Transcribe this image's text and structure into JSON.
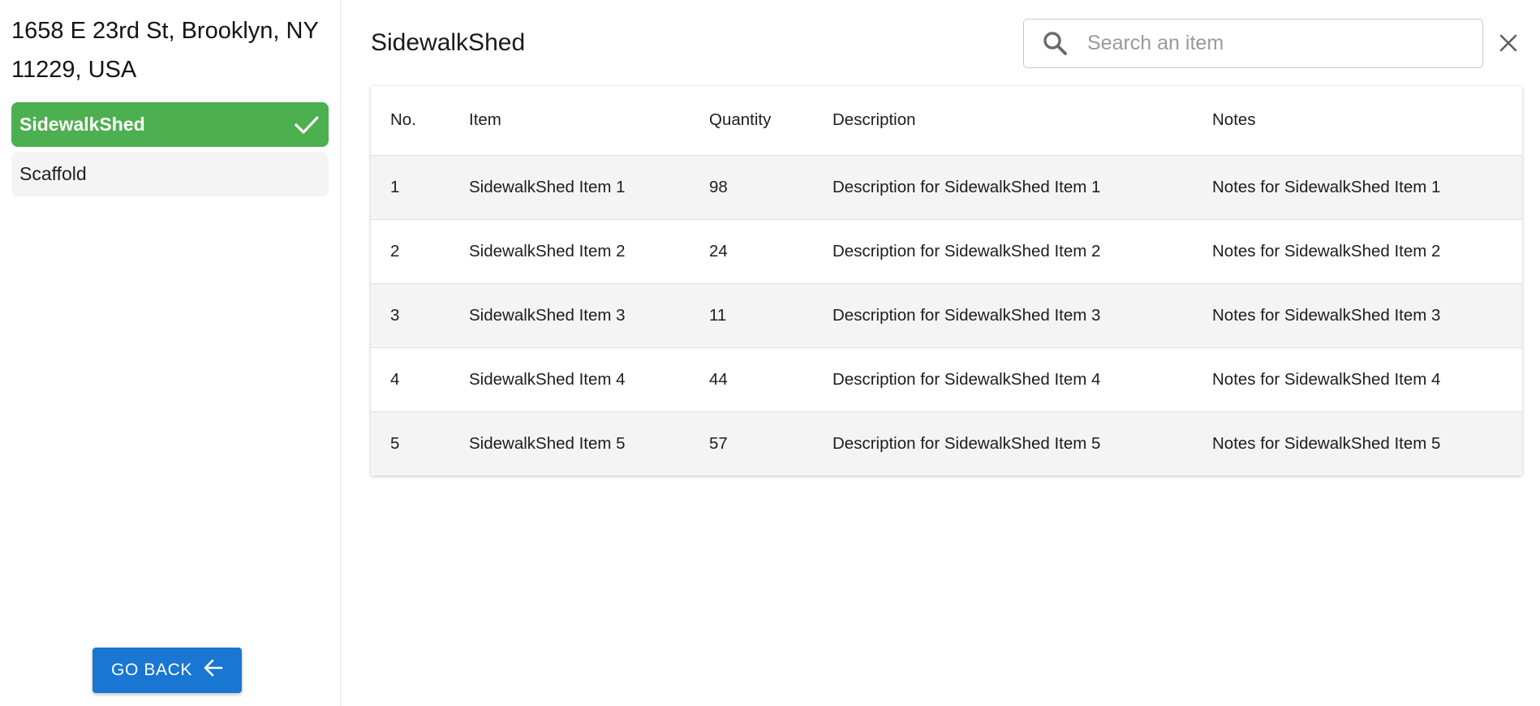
{
  "sidebar": {
    "address": "1658 E 23rd St, Brooklyn, NY 11229, USA",
    "items": [
      {
        "label": "SidewalkShed",
        "active": true,
        "icon": "check-icon"
      },
      {
        "label": "Scaffold",
        "active": false
      }
    ],
    "go_back_label": "GO BACK"
  },
  "header": {
    "title": "SidewalkShed",
    "search_placeholder": "Search an item",
    "search_value": ""
  },
  "table": {
    "columns": [
      "No.",
      "Item",
      "Quantity",
      "Description",
      "Notes"
    ],
    "rows": [
      {
        "no": "1",
        "item": "SidewalkShed Item 1",
        "quantity": "98",
        "description": "Description for SidewalkShed Item 1",
        "notes": "Notes for SidewalkShed Item 1"
      },
      {
        "no": "2",
        "item": "SidewalkShed Item 2",
        "quantity": "24",
        "description": "Description for SidewalkShed Item 2",
        "notes": "Notes for SidewalkShed Item 2"
      },
      {
        "no": "3",
        "item": "SidewalkShed Item 3",
        "quantity": "11",
        "description": "Description for SidewalkShed Item 3",
        "notes": "Notes for SidewalkShed Item 3"
      },
      {
        "no": "4",
        "item": "SidewalkShed Item 4",
        "quantity": "44",
        "description": "Description for SidewalkShed Item 4",
        "notes": "Notes for SidewalkShed Item 4"
      },
      {
        "no": "5",
        "item": "SidewalkShed Item 5",
        "quantity": "57",
        "description": "Description for SidewalkShed Item 5",
        "notes": "Notes for SidewalkShed Item 5"
      }
    ]
  },
  "colors": {
    "active_item": "#4caf50",
    "primary_button": "#1976d2"
  }
}
